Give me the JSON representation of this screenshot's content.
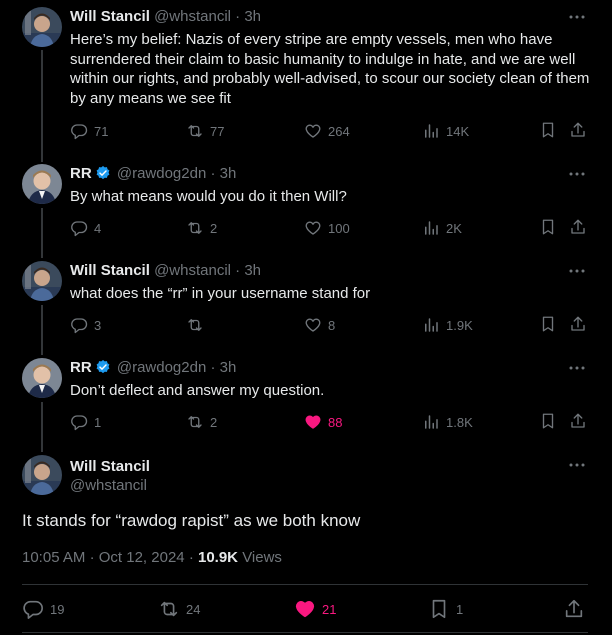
{
  "colors": {
    "background": "#000000",
    "text": "#e7e9ea",
    "muted": "#71767b",
    "verified": "#1d9bf0",
    "like": "#f91880",
    "divider": "#2f3336"
  },
  "tweets": [
    {
      "name": "Will Stancil",
      "handle": "@whstancil",
      "dot": "·",
      "time": "3h",
      "verified": false,
      "text": "Here’s my belief: Nazis of every stripe are empty vessels, men who have surrendered their claim to basic humanity to indulge in hate, and we are well within our rights, and probably well-advised, to scour our society clean of them by any means we see fit",
      "replies": "71",
      "reposts": "77",
      "likes": "264",
      "views": "14K",
      "liked": false
    },
    {
      "name": "RR",
      "handle": "@rawdog2dn",
      "dot": "·",
      "time": "3h",
      "verified": true,
      "text": "By what means would you do it then Will?",
      "replies": "4",
      "reposts": "2",
      "likes": "100",
      "views": "2K",
      "liked": false
    },
    {
      "name": "Will Stancil",
      "handle": "@whstancil",
      "dot": "·",
      "time": "3h",
      "verified": false,
      "text": "what does the “rr” in your username stand for",
      "replies": "3",
      "reposts": "",
      "likes": "8",
      "views": "1.9K",
      "liked": false
    },
    {
      "name": "RR",
      "handle": "@rawdog2dn",
      "dot": "·",
      "time": "3h",
      "verified": true,
      "text": "Don’t deflect and answer my question.",
      "replies": "1",
      "reposts": "2",
      "likes": "88",
      "views": "1.8K",
      "liked": true
    }
  ],
  "main_tweet": {
    "name": "Will Stancil",
    "handle": "@whstancil",
    "text": "It stands for “rawdog rapist” as we both know",
    "time": "10:05 AM",
    "dot1": "·",
    "date": "Oct 12, 2024",
    "dot2": "·",
    "views_count": "10.9K",
    "views_label": "Views",
    "replies": "19",
    "reposts": "24",
    "likes": "21",
    "bookmarks": "1",
    "liked": true
  },
  "icons": [
    "more-icon",
    "verified-icon",
    "reply-icon",
    "repost-icon",
    "like-icon",
    "views-icon",
    "bookmark-icon",
    "share-icon"
  ]
}
